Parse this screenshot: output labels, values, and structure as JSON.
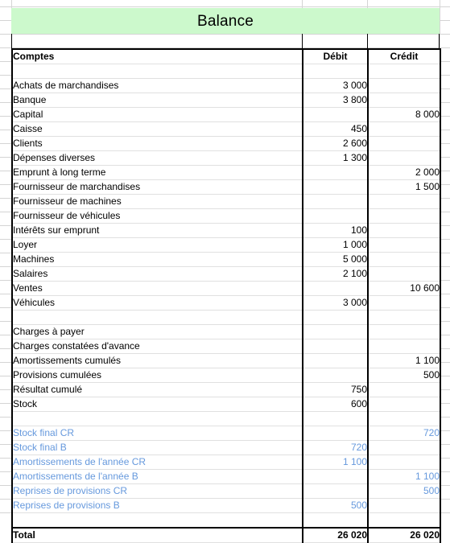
{
  "title": {
    "text": "Balance",
    "background_color": "#ccf9cc"
  },
  "table": {
    "columns": {
      "account": "Comptes",
      "debit": "Débit",
      "credit": "Crédit"
    },
    "blue_text_color": "#6699dd",
    "rows": [
      {
        "type": "spacer",
        "account": "",
        "debit": "",
        "credit": ""
      },
      {
        "type": "normal",
        "account": "Achats de marchandises",
        "debit": "3 000",
        "credit": ""
      },
      {
        "type": "normal",
        "account": "Banque",
        "debit": "3 800",
        "credit": ""
      },
      {
        "type": "normal",
        "account": "Capital",
        "debit": "",
        "credit": "8 000"
      },
      {
        "type": "normal",
        "account": "Caisse",
        "debit": "450",
        "credit": ""
      },
      {
        "type": "normal",
        "account": "Clients",
        "debit": "2 600",
        "credit": ""
      },
      {
        "type": "normal",
        "account": "Dépenses diverses",
        "debit": "1 300",
        "credit": ""
      },
      {
        "type": "normal",
        "account": "Emprunt à long terme",
        "debit": "",
        "credit": "2 000"
      },
      {
        "type": "normal",
        "account": "Fournisseur de marchandises",
        "debit": "",
        "credit": "1 500"
      },
      {
        "type": "normal",
        "account": "Fournisseur de machines",
        "debit": "",
        "credit": ""
      },
      {
        "type": "normal",
        "account": "Fournisseur de véhicules",
        "debit": "",
        "credit": ""
      },
      {
        "type": "normal",
        "account": "Intérêts sur emprunt",
        "debit": "100",
        "credit": ""
      },
      {
        "type": "normal",
        "account": "Loyer",
        "debit": "1 000",
        "credit": ""
      },
      {
        "type": "normal",
        "account": "Machines",
        "debit": "5 000",
        "credit": ""
      },
      {
        "type": "normal",
        "account": "Salaires",
        "debit": "2 100",
        "credit": ""
      },
      {
        "type": "normal",
        "account": "Ventes",
        "debit": "",
        "credit": "10 600"
      },
      {
        "type": "normal",
        "account": "Véhicules",
        "debit": "3 000",
        "credit": ""
      },
      {
        "type": "spacer",
        "account": "",
        "debit": "",
        "credit": ""
      },
      {
        "type": "normal",
        "account": "Charges à payer",
        "debit": "",
        "credit": ""
      },
      {
        "type": "normal",
        "account": "Charges constatées d'avance",
        "debit": "",
        "credit": ""
      },
      {
        "type": "normal",
        "account": "Amortissements cumulés",
        "debit": "",
        "credit": "1 100"
      },
      {
        "type": "normal",
        "account": "Provisions cumulées",
        "debit": "",
        "credit": "500"
      },
      {
        "type": "normal",
        "account": "Résultat cumulé",
        "debit": "750",
        "credit": ""
      },
      {
        "type": "normal",
        "account": "Stock",
        "debit": "600",
        "credit": ""
      },
      {
        "type": "spacer",
        "account": "",
        "debit": "",
        "credit": ""
      },
      {
        "type": "blue",
        "account": "Stock final CR",
        "debit": "",
        "credit": "720"
      },
      {
        "type": "blue",
        "account": "Stock final B",
        "debit": "720",
        "credit": ""
      },
      {
        "type": "blue",
        "account": "Amortissements de l'année CR",
        "debit": "1 100",
        "credit": ""
      },
      {
        "type": "blue",
        "account": "Amortissements de l'année B",
        "debit": "",
        "credit": "1 100"
      },
      {
        "type": "blue",
        "account": "Reprises de provisions CR",
        "debit": "",
        "credit": "500"
      },
      {
        "type": "blue",
        "account": "Reprises de provisions B",
        "debit": "500",
        "credit": ""
      },
      {
        "type": "spacer",
        "account": "",
        "debit": "",
        "credit": ""
      },
      {
        "type": "total",
        "account": "Total",
        "debit": "26 020",
        "credit": "26 020"
      }
    ]
  }
}
